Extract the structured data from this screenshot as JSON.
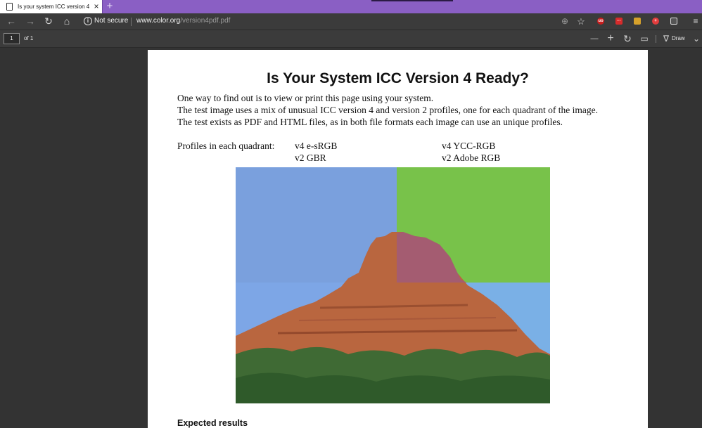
{
  "browser": {
    "tab_title": "Is your system ICC version 4 rea",
    "tab_close": "×",
    "new_tab": "+",
    "security_label": "Not secure",
    "url_domain": "www.color.org",
    "url_path": "/version4pdf.pdf",
    "back": "←",
    "forward": "→",
    "refresh": "↻",
    "home": "⌂",
    "zoom": "⊕",
    "favorite": "☆",
    "hub": "≡"
  },
  "pdf_toolbar": {
    "page_number": "1",
    "page_total": "of 1",
    "zoom_out": "—",
    "zoom_in": "+",
    "rotate": "↻",
    "fit": "▭",
    "draw_label": "Draw",
    "draw_icon": "∇",
    "more": "⌄"
  },
  "document": {
    "title": "Is Your System ICC Version 4 Ready?",
    "para1": "One way to find out is to view or print this page using your system.",
    "para2": "The test image uses a mix of unusual ICC version 4 and version 2 profiles, one for each quadrant of the image.",
    "para3": "The test exists as PDF and HTML files, as in both file formats each image can use an unique profiles.",
    "profiles_label": "Profiles in each quadrant:",
    "q_top_left": "v4 e-sRGB",
    "q_top_right": "v4 YCC-RGB",
    "q_bottom_left": "v2 GBR",
    "q_bottom_right": "v2 Adobe RGB",
    "expected_heading": "Expected results"
  },
  "colors": {
    "tab_bar": "#8a5fc4",
    "toolbar": "#3b3b3b",
    "viewer_background": "#333333",
    "sky_blue": "#7aa3e0",
    "quadrant_green": "#7cc34a",
    "rock_red": "#b5603f"
  }
}
